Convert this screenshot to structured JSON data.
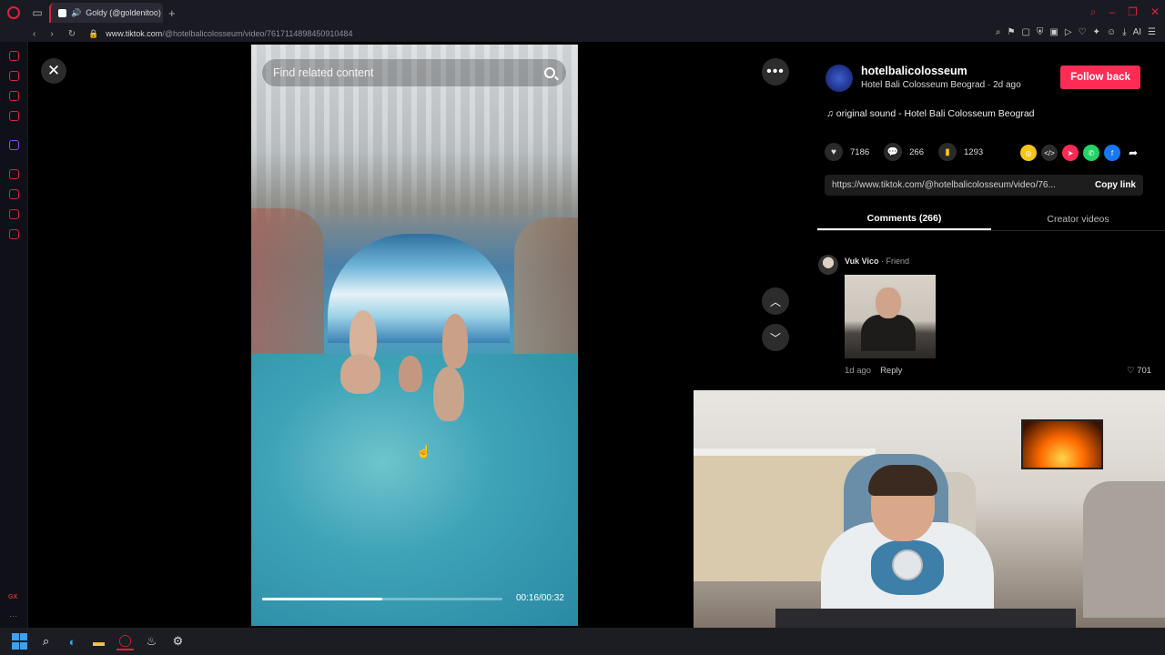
{
  "browser": {
    "tab_title": "Goldy (@goldenitoo) |",
    "new_tab_symbol": "+",
    "url_domain": "www.tiktok.com",
    "url_path": "/@hotelbalicolosseum/video/7617114898450910484",
    "aria_label": "AI"
  },
  "video": {
    "search_placeholder": "Find related content",
    "time": "00:16/00:32",
    "progress_fraction": 0.5
  },
  "creator": {
    "username": "hotelbalicolosseum",
    "display_line": "Hotel Bali Colosseum Beograd · 2d ago",
    "follow_label": "Follow back",
    "sound": "original sound - Hotel Bali Colosseum Beograd"
  },
  "stats": {
    "likes": "7186",
    "comments": "266",
    "saves": "1293"
  },
  "share": {
    "link": "https://www.tiktok.com/@hotelbalicolosseum/video/76...",
    "copy_label": "Copy link",
    "colors": {
      "coin": "#f5c518",
      "embed": "#2c2c2c",
      "send": "#fe2c55",
      "whatsapp": "#25d366",
      "facebook": "#1877f2"
    }
  },
  "tabs": {
    "comments": "Comments (266)",
    "creator_videos": "Creator videos"
  },
  "comment": {
    "author": "Vuk Vico",
    "relation": " · Friend",
    "age": "1d ago",
    "reply": "Reply",
    "likes": "701"
  },
  "colors": {
    "accent": "#fe2c55",
    "opera_red": "#e0213c"
  }
}
